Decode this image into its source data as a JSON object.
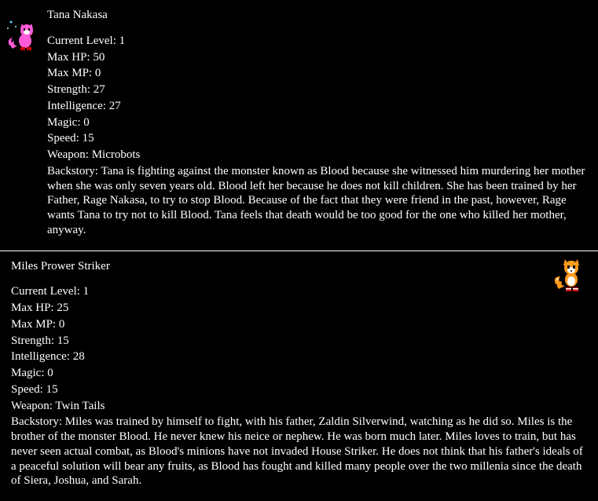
{
  "characters": [
    {
      "name": "Tana Nakasa",
      "sprite_name": "pink-fox-sprite",
      "stats": {
        "level_label": "Current Level:  1",
        "hp_label": "Max HP:  50",
        "mp_label": "Max MP:  0",
        "str_label": "Strength:  27",
        "int_label": "Intelligence:  27",
        "mag_label": "Magic:  0",
        "spd_label": "Speed:  15",
        "weapon_label": "Weapon:  Microbots"
      },
      "backstory": "Backstory:  Tana is fighting against the monster known as Blood because she witnessed him murdering her mother when she was only seven years old.  Blood left her because he does not kill children.  She has been trained by her Father, Rage Nakasa, to try to stop Blood.  Because of the fact that they were friend in the past, however, Rage wants Tana to try not to kill Blood.  Tana feels that death would be too good for the one who killed her mother, anyway."
    },
    {
      "name": "Miles Prower Striker",
      "sprite_name": "orange-fox-sprite",
      "stats": {
        "level_label": "Current Level:  1",
        "hp_label": "Max HP:  25",
        "mp_label": "Max MP:  0",
        "str_label": "Strength:  15",
        "int_label": "Intelligence:  28",
        "mag_label": "Magic:  0",
        "spd_label": "Speed:  15",
        "weapon_label": "Weapon:  Twin Tails"
      },
      "backstory": "Backstory:  Miles was trained by himself to fight, with his father, Zaldin Silverwind, watching as he did so.  Miles is the brother of the monster Blood.  He never knew his neice or nephew.  He was born much later.  Miles loves to train, but has never seen actual combat, as Blood's minions have not invaded House Striker.  He does not think that his father's ideals of a peaceful solution will bear any fruits, as Blood has fought and killed many people over the two millenia since the death of Siera, Joshua, and Sarah."
    }
  ]
}
